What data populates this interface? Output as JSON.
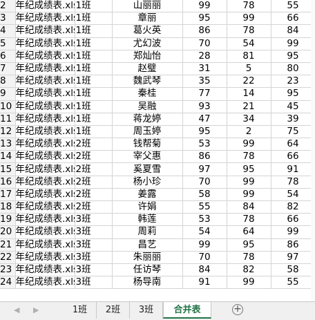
{
  "rows": [
    {
      "n": "2",
      "file": "年纪成绩表.xlsx",
      "cls": "1班",
      "name": "山丽丽",
      "a": "99",
      "b": "78",
      "c": "55"
    },
    {
      "n": "3",
      "file": "年纪成绩表.xlsx",
      "cls": "1班",
      "name": "章丽",
      "a": "95",
      "b": "99",
      "c": "66"
    },
    {
      "n": "4",
      "file": "年纪成绩表.xlsx",
      "cls": "1班",
      "name": "葛火英",
      "a": "86",
      "b": "78",
      "c": "84"
    },
    {
      "n": "5",
      "file": "年纪成绩表.xlsx",
      "cls": "1班",
      "name": "尤幻波",
      "a": "70",
      "b": "54",
      "c": "99"
    },
    {
      "n": "6",
      "file": "年纪成绩表.xlsx",
      "cls": "1班",
      "name": "郑灿怡",
      "a": "28",
      "b": "81",
      "c": "95"
    },
    {
      "n": "7",
      "file": "年纪成绩表.xlsx",
      "cls": "1班",
      "name": "赵璧",
      "a": "31",
      "b": "5",
      "c": "80"
    },
    {
      "n": "8",
      "file": "年纪成绩表.xlsx",
      "cls": "1班",
      "name": "魏武琴",
      "a": "35",
      "b": "22",
      "c": "23"
    },
    {
      "n": "9",
      "file": "年纪成绩表.xlsx",
      "cls": "1班",
      "name": "秦桂",
      "a": "77",
      "b": "14",
      "c": "95"
    },
    {
      "n": "10",
      "file": "年纪成绩表.xlsx",
      "cls": "1班",
      "name": "吴融",
      "a": "93",
      "b": "21",
      "c": "45"
    },
    {
      "n": "11",
      "file": "年纪成绩表.xlsx",
      "cls": "1班",
      "name": "蒋龙婷",
      "a": "47",
      "b": "34",
      "c": "39"
    },
    {
      "n": "12",
      "file": "年纪成绩表.xlsx",
      "cls": "1班",
      "name": "周玉婷",
      "a": "95",
      "b": "2",
      "c": "75"
    },
    {
      "n": "13",
      "file": "年纪成绩表.xlsx",
      "cls": "2班",
      "name": "钱帮菊",
      "a": "53",
      "b": "99",
      "c": "64"
    },
    {
      "n": "14",
      "file": "年纪成绩表.xlsx",
      "cls": "2班",
      "name": "宰父惠",
      "a": "86",
      "b": "78",
      "c": "66"
    },
    {
      "n": "15",
      "file": "年纪成绩表.xlsx",
      "cls": "2班",
      "name": "奚夏雪",
      "a": "97",
      "b": "95",
      "c": "91"
    },
    {
      "n": "16",
      "file": "年纪成绩表.xlsx",
      "cls": "2班",
      "name": "杨小珍",
      "a": "70",
      "b": "99",
      "c": "78"
    },
    {
      "n": "17",
      "file": "年纪成绩表.xlsx",
      "cls": "2班",
      "name": "姜露",
      "a": "58",
      "b": "99",
      "c": "54"
    },
    {
      "n": "18",
      "file": "年纪成绩表.xlsx",
      "cls": "2班",
      "name": "许娟",
      "a": "55",
      "b": "84",
      "c": "82"
    },
    {
      "n": "19",
      "file": "年纪成绩表.xlsx",
      "cls": "3班",
      "name": "韩莲",
      "a": "53",
      "b": "78",
      "c": "66"
    },
    {
      "n": "20",
      "file": "年纪成绩表.xlsx",
      "cls": "3班",
      "name": "周莉",
      "a": "54",
      "b": "64",
      "c": "99"
    },
    {
      "n": "21",
      "file": "年纪成绩表.xlsx",
      "cls": "3班",
      "name": "昌艺",
      "a": "99",
      "b": "95",
      "c": "86"
    },
    {
      "n": "22",
      "file": "年纪成绩表.xlsx",
      "cls": "3班",
      "name": "朱丽丽",
      "a": "70",
      "b": "78",
      "c": "97"
    },
    {
      "n": "23",
      "file": "年纪成绩表.xlsx",
      "cls": "3班",
      "name": "任访琴",
      "a": "84",
      "b": "82",
      "c": "58"
    },
    {
      "n": "24",
      "file": "年纪成绩表.xlsx",
      "cls": "3班",
      "name": "杨导南",
      "a": "91",
      "b": "99",
      "c": "55"
    }
  ],
  "tabs": {
    "nav_prev": "◀",
    "nav_next": "▶",
    "items": [
      "1班",
      "2班",
      "3班",
      "合并表"
    ],
    "active_index": 3,
    "add_symbol": "+"
  },
  "colors": {
    "active_tab": "#217346",
    "gridline": "#d4d4d4",
    "row_header_bg": "#f3f3f3"
  }
}
